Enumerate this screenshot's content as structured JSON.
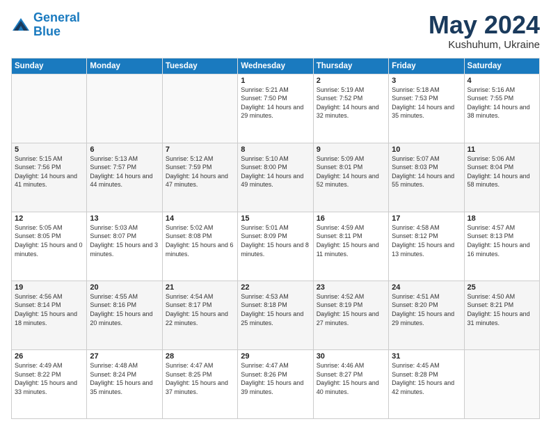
{
  "logo": {
    "line1": "General",
    "line2": "Blue"
  },
  "title": "May 2024",
  "location": "Kushuhum, Ukraine",
  "days_header": [
    "Sunday",
    "Monday",
    "Tuesday",
    "Wednesday",
    "Thursday",
    "Friday",
    "Saturday"
  ],
  "weeks": [
    [
      {
        "day": "",
        "sunrise": "",
        "sunset": "",
        "daylight": ""
      },
      {
        "day": "",
        "sunrise": "",
        "sunset": "",
        "daylight": ""
      },
      {
        "day": "",
        "sunrise": "",
        "sunset": "",
        "daylight": ""
      },
      {
        "day": "1",
        "sunrise": "Sunrise: 5:21 AM",
        "sunset": "Sunset: 7:50 PM",
        "daylight": "Daylight: 14 hours and 29 minutes."
      },
      {
        "day": "2",
        "sunrise": "Sunrise: 5:19 AM",
        "sunset": "Sunset: 7:52 PM",
        "daylight": "Daylight: 14 hours and 32 minutes."
      },
      {
        "day": "3",
        "sunrise": "Sunrise: 5:18 AM",
        "sunset": "Sunset: 7:53 PM",
        "daylight": "Daylight: 14 hours and 35 minutes."
      },
      {
        "day": "4",
        "sunrise": "Sunrise: 5:16 AM",
        "sunset": "Sunset: 7:55 PM",
        "daylight": "Daylight: 14 hours and 38 minutes."
      }
    ],
    [
      {
        "day": "5",
        "sunrise": "Sunrise: 5:15 AM",
        "sunset": "Sunset: 7:56 PM",
        "daylight": "Daylight: 14 hours and 41 minutes."
      },
      {
        "day": "6",
        "sunrise": "Sunrise: 5:13 AM",
        "sunset": "Sunset: 7:57 PM",
        "daylight": "Daylight: 14 hours and 44 minutes."
      },
      {
        "day": "7",
        "sunrise": "Sunrise: 5:12 AM",
        "sunset": "Sunset: 7:59 PM",
        "daylight": "Daylight: 14 hours and 47 minutes."
      },
      {
        "day": "8",
        "sunrise": "Sunrise: 5:10 AM",
        "sunset": "Sunset: 8:00 PM",
        "daylight": "Daylight: 14 hours and 49 minutes."
      },
      {
        "day": "9",
        "sunrise": "Sunrise: 5:09 AM",
        "sunset": "Sunset: 8:01 PM",
        "daylight": "Daylight: 14 hours and 52 minutes."
      },
      {
        "day": "10",
        "sunrise": "Sunrise: 5:07 AM",
        "sunset": "Sunset: 8:03 PM",
        "daylight": "Daylight: 14 hours and 55 minutes."
      },
      {
        "day": "11",
        "sunrise": "Sunrise: 5:06 AM",
        "sunset": "Sunset: 8:04 PM",
        "daylight": "Daylight: 14 hours and 58 minutes."
      }
    ],
    [
      {
        "day": "12",
        "sunrise": "Sunrise: 5:05 AM",
        "sunset": "Sunset: 8:05 PM",
        "daylight": "Daylight: 15 hours and 0 minutes."
      },
      {
        "day": "13",
        "sunrise": "Sunrise: 5:03 AM",
        "sunset": "Sunset: 8:07 PM",
        "daylight": "Daylight: 15 hours and 3 minutes."
      },
      {
        "day": "14",
        "sunrise": "Sunrise: 5:02 AM",
        "sunset": "Sunset: 8:08 PM",
        "daylight": "Daylight: 15 hours and 6 minutes."
      },
      {
        "day": "15",
        "sunrise": "Sunrise: 5:01 AM",
        "sunset": "Sunset: 8:09 PM",
        "daylight": "Daylight: 15 hours and 8 minutes."
      },
      {
        "day": "16",
        "sunrise": "Sunrise: 4:59 AM",
        "sunset": "Sunset: 8:11 PM",
        "daylight": "Daylight: 15 hours and 11 minutes."
      },
      {
        "day": "17",
        "sunrise": "Sunrise: 4:58 AM",
        "sunset": "Sunset: 8:12 PM",
        "daylight": "Daylight: 15 hours and 13 minutes."
      },
      {
        "day": "18",
        "sunrise": "Sunrise: 4:57 AM",
        "sunset": "Sunset: 8:13 PM",
        "daylight": "Daylight: 15 hours and 16 minutes."
      }
    ],
    [
      {
        "day": "19",
        "sunrise": "Sunrise: 4:56 AM",
        "sunset": "Sunset: 8:14 PM",
        "daylight": "Daylight: 15 hours and 18 minutes."
      },
      {
        "day": "20",
        "sunrise": "Sunrise: 4:55 AM",
        "sunset": "Sunset: 8:16 PM",
        "daylight": "Daylight: 15 hours and 20 minutes."
      },
      {
        "day": "21",
        "sunrise": "Sunrise: 4:54 AM",
        "sunset": "Sunset: 8:17 PM",
        "daylight": "Daylight: 15 hours and 22 minutes."
      },
      {
        "day": "22",
        "sunrise": "Sunrise: 4:53 AM",
        "sunset": "Sunset: 8:18 PM",
        "daylight": "Daylight: 15 hours and 25 minutes."
      },
      {
        "day": "23",
        "sunrise": "Sunrise: 4:52 AM",
        "sunset": "Sunset: 8:19 PM",
        "daylight": "Daylight: 15 hours and 27 minutes."
      },
      {
        "day": "24",
        "sunrise": "Sunrise: 4:51 AM",
        "sunset": "Sunset: 8:20 PM",
        "daylight": "Daylight: 15 hours and 29 minutes."
      },
      {
        "day": "25",
        "sunrise": "Sunrise: 4:50 AM",
        "sunset": "Sunset: 8:21 PM",
        "daylight": "Daylight: 15 hours and 31 minutes."
      }
    ],
    [
      {
        "day": "26",
        "sunrise": "Sunrise: 4:49 AM",
        "sunset": "Sunset: 8:22 PM",
        "daylight": "Daylight: 15 hours and 33 minutes."
      },
      {
        "day": "27",
        "sunrise": "Sunrise: 4:48 AM",
        "sunset": "Sunset: 8:24 PM",
        "daylight": "Daylight: 15 hours and 35 minutes."
      },
      {
        "day": "28",
        "sunrise": "Sunrise: 4:47 AM",
        "sunset": "Sunset: 8:25 PM",
        "daylight": "Daylight: 15 hours and 37 minutes."
      },
      {
        "day": "29",
        "sunrise": "Sunrise: 4:47 AM",
        "sunset": "Sunset: 8:26 PM",
        "daylight": "Daylight: 15 hours and 39 minutes."
      },
      {
        "day": "30",
        "sunrise": "Sunrise: 4:46 AM",
        "sunset": "Sunset: 8:27 PM",
        "daylight": "Daylight: 15 hours and 40 minutes."
      },
      {
        "day": "31",
        "sunrise": "Sunrise: 4:45 AM",
        "sunset": "Sunset: 8:28 PM",
        "daylight": "Daylight: 15 hours and 42 minutes."
      },
      {
        "day": "",
        "sunrise": "",
        "sunset": "",
        "daylight": ""
      }
    ]
  ]
}
